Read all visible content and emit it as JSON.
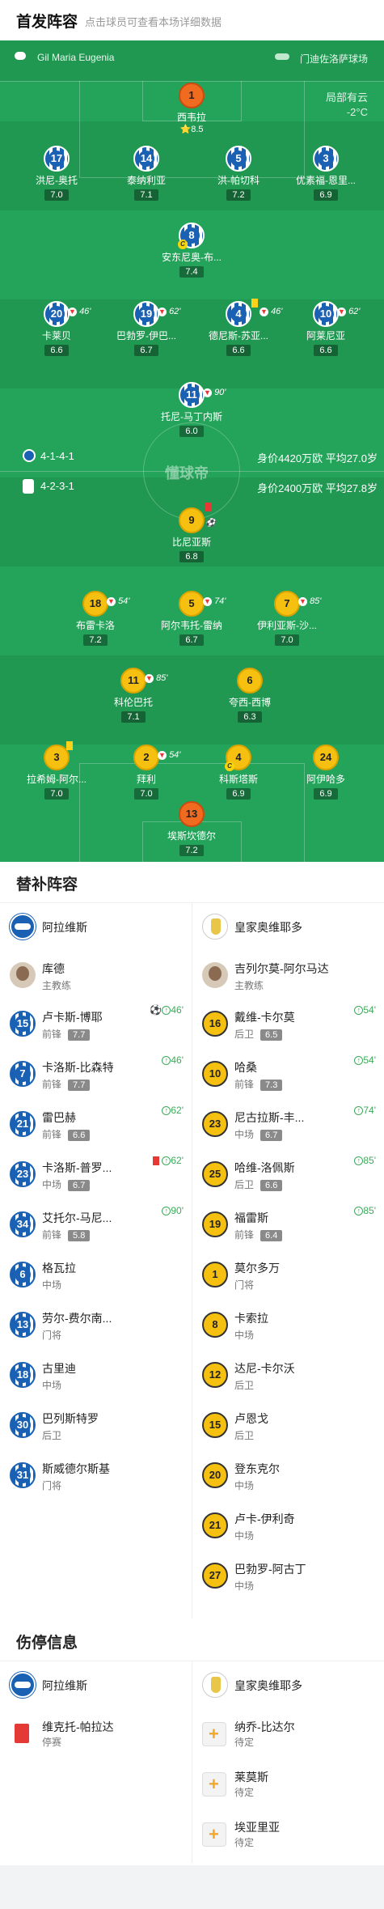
{
  "header": {
    "title": "首发阵容",
    "subtitle": "点击球员可查看本场详细数据"
  },
  "pitch": {
    "home_team": "Gil Maria Eugenia",
    "away_team": "门迪佐洛萨球场",
    "weather_line1": "局部有云",
    "weather_line2": "-2°C",
    "watermark": "懂球帝",
    "home_formation": "4-1-4-1",
    "home_value": "身价4420万欧 平均27.0岁",
    "away_formation": "4-2-3-1",
    "away_value": "身价2400万欧 平均27.8岁",
    "star_rating": "8.5"
  },
  "home_players": [
    {
      "num": "1",
      "name": "西韦拉",
      "rating": "8.5"
    },
    {
      "num": "17",
      "name": "洪尼-奥托",
      "rating": "7.0"
    },
    {
      "num": "14",
      "name": "泰纳利亚",
      "rating": "7.1"
    },
    {
      "num": "5",
      "name": "洪-帕切科",
      "rating": "7.2"
    },
    {
      "num": "3",
      "name": "优素福-恩里...",
      "rating": "6.9"
    },
    {
      "num": "8",
      "name": "安东尼奥-布...",
      "rating": "7.4"
    },
    {
      "num": "20",
      "name": "卡莱贝",
      "rating": "6.6",
      "sub": "46'"
    },
    {
      "num": "19",
      "name": "巴勃罗-伊巴...",
      "rating": "6.7",
      "sub": "62'"
    },
    {
      "num": "4",
      "name": "德尼斯-苏亚...",
      "rating": "6.6",
      "sub": "46'"
    },
    {
      "num": "10",
      "name": "阿莱尼亚",
      "rating": "6.6",
      "sub": "62'"
    },
    {
      "num": "11",
      "name": "托尼-马丁内斯",
      "rating": "6.0",
      "sub": "90'"
    }
  ],
  "away_players": [
    {
      "num": "9",
      "name": "比尼亚斯",
      "rating": "6.8"
    },
    {
      "num": "18",
      "name": "布雷卡洛",
      "rating": "7.2",
      "sub": "54'"
    },
    {
      "num": "5",
      "name": "阿尔韦托-雷纳",
      "rating": "6.7",
      "sub": "74'"
    },
    {
      "num": "7",
      "name": "伊利亚斯-沙...",
      "rating": "7.0",
      "sub": "85'"
    },
    {
      "num": "11",
      "name": "科伦巴托",
      "rating": "7.1",
      "sub": "85'"
    },
    {
      "num": "6",
      "name": "夸西-西博",
      "rating": "6.3"
    },
    {
      "num": "3",
      "name": "拉希姆-阿尔...",
      "rating": "7.0"
    },
    {
      "num": "2",
      "name": "拜利",
      "rating": "7.0",
      "sub": "54'"
    },
    {
      "num": "4",
      "name": "科斯塔斯",
      "rating": "6.9"
    },
    {
      "num": "24",
      "name": "阿伊哈多",
      "rating": "6.9"
    },
    {
      "num": "13",
      "name": "埃斯坎德尔",
      "rating": "7.2"
    }
  ],
  "subs": {
    "title": "替补阵容",
    "home_team": "阿拉维斯",
    "away_team": "皇家奥维耶多",
    "home_coach": "库德",
    "away_coach": "吉列尔莫-阿尔马达",
    "coach_label": "主教练",
    "home": [
      {
        "num": "15",
        "name": "卢卡斯-博耶",
        "pos": "前锋",
        "rating": "7.7",
        "evt": "46'"
      },
      {
        "num": "7",
        "name": "卡洛斯-比森特",
        "pos": "前锋",
        "rating": "7.7",
        "evt": "46'"
      },
      {
        "num": "21",
        "name": "雷巴赫",
        "pos": "前锋",
        "rating": "6.6",
        "evt": "62'"
      },
      {
        "num": "23",
        "name": "卡洛斯-普罗...",
        "pos": "中场",
        "rating": "6.7",
        "evt": "62'"
      },
      {
        "num": "34",
        "name": "艾托尔-马尼...",
        "pos": "前锋",
        "rating": "5.8",
        "evt": "90'"
      },
      {
        "num": "6",
        "name": "格瓦拉",
        "pos": "中场"
      },
      {
        "num": "13",
        "name": "劳尔-费尔南...",
        "pos": "门将"
      },
      {
        "num": "18",
        "name": "古里迪",
        "pos": "中场"
      },
      {
        "num": "30",
        "name": "巴列斯特罗",
        "pos": "后卫"
      },
      {
        "num": "31",
        "name": "斯威德尔斯基",
        "pos": "门将"
      }
    ],
    "away": [
      {
        "num": "16",
        "name": "戴维-卡尔莫",
        "pos": "后卫",
        "rating": "6.5",
        "evt": "54'"
      },
      {
        "num": "10",
        "name": "哈桑",
        "pos": "前锋",
        "rating": "7.3",
        "evt": "54'"
      },
      {
        "num": "23",
        "name": "尼古拉斯-丰...",
        "pos": "中场",
        "rating": "6.7",
        "evt": "74'"
      },
      {
        "num": "25",
        "name": "哈维-洛佩斯",
        "pos": "后卫",
        "rating": "6.6",
        "evt": "85'"
      },
      {
        "num": "19",
        "name": "福雷斯",
        "pos": "前锋",
        "rating": "6.4",
        "evt": "85'"
      },
      {
        "num": "1",
        "name": "莫尔多万",
        "pos": "门将"
      },
      {
        "num": "8",
        "name": "卡索拉",
        "pos": "中场"
      },
      {
        "num": "12",
        "name": "达尼-卡尔沃",
        "pos": "后卫"
      },
      {
        "num": "15",
        "name": "卢恩戈",
        "pos": "后卫"
      },
      {
        "num": "20",
        "name": "登东克尔",
        "pos": "中场"
      },
      {
        "num": "21",
        "name": "卢卡-伊利奇",
        "pos": "中场"
      },
      {
        "num": "27",
        "name": "巴勃罗-阿古丁",
        "pos": "中场"
      }
    ]
  },
  "injuries": {
    "title": "伤停信息",
    "home_team": "阿拉维斯",
    "away_team": "皇家奥维耶多",
    "home": [
      {
        "name": "维克托-帕拉达",
        "status": "停赛"
      }
    ],
    "away": [
      {
        "name": "纳乔-比达尔",
        "status": "待定"
      },
      {
        "name": "莱莫斯",
        "status": "待定"
      },
      {
        "name": "埃亚里亚",
        "status": "待定"
      }
    ]
  }
}
